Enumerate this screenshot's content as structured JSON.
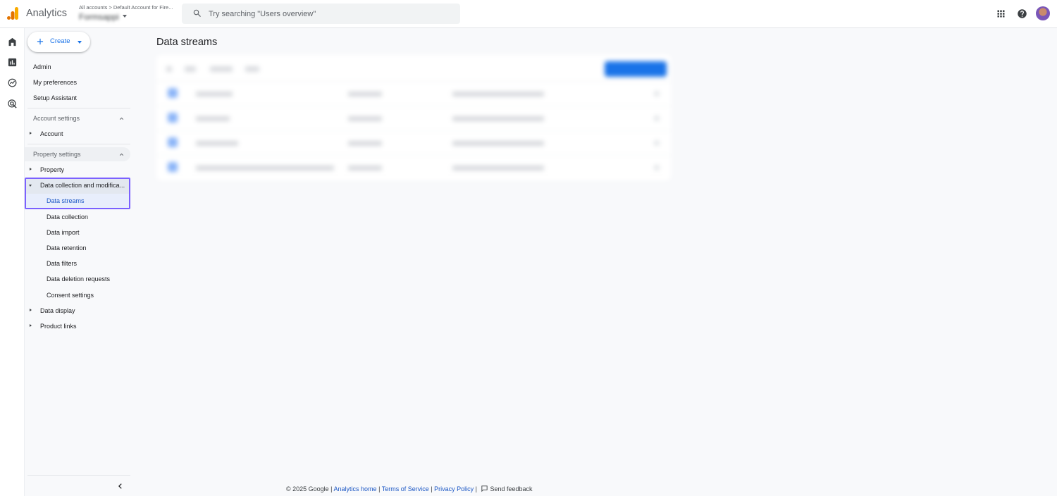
{
  "header": {
    "app_name": "Analytics",
    "breadcrumb_root": "All accounts",
    "breadcrumb_account": "Default Account for Fire...",
    "property_name": "Formsappi",
    "search_placeholder": "Try searching \"Users overview\""
  },
  "icons": {
    "logo": "analytics-logo-icon",
    "search": "search-icon",
    "apps": "apps-grid-icon",
    "help": "help-icon",
    "account": "avatar",
    "rail": [
      "home-icon",
      "reports-icon",
      "explore-icon",
      "advertising-icon"
    ],
    "admin": "gear-icon"
  },
  "sidenav": {
    "create_label": "Create",
    "top_links": [
      "Admin",
      "My preferences",
      "Setup Assistant"
    ],
    "account_settings": {
      "label": "Account settings",
      "items": [
        "Account"
      ]
    },
    "property_settings": {
      "label": "Property settings",
      "items": [
        "Property"
      ]
    },
    "data_collection": {
      "label": "Data collection and modifica...",
      "children": [
        "Data streams",
        "Data collection",
        "Data import",
        "Data retention",
        "Data filters",
        "Data deletion requests",
        "Consent settings"
      ],
      "active": "Data streams"
    },
    "more_sections": [
      "Data display",
      "Product links"
    ]
  },
  "main": {
    "title": "Data streams"
  },
  "footer": {
    "copyright": "© 2025 Google |",
    "links": [
      "Analytics home",
      "Terms of Service",
      "Privacy Policy"
    ],
    "feedback": "Send feedback"
  },
  "colors": {
    "accent": "#1a73e8",
    "highlight_border": "#7b61ff",
    "background": "#f8f9fb"
  }
}
